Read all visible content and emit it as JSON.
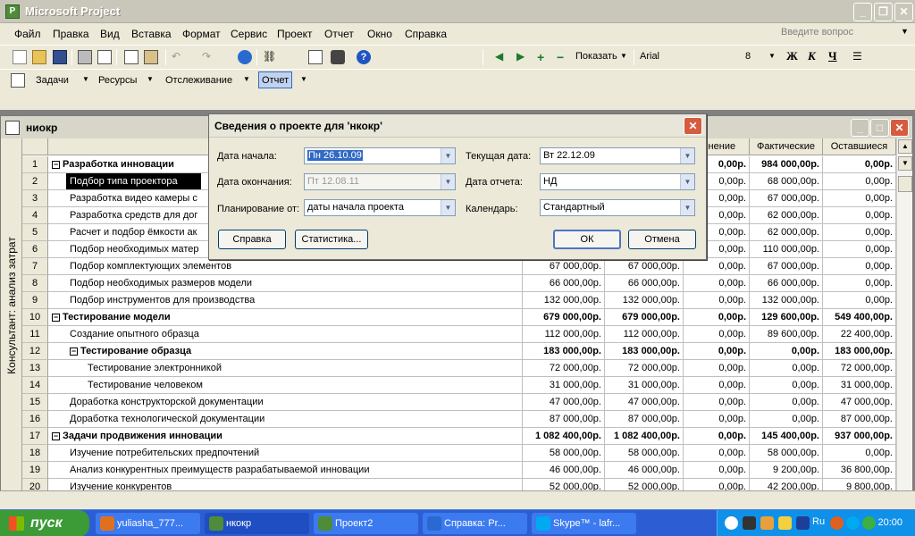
{
  "app": {
    "title": "Microsoft Project"
  },
  "menu": {
    "items": [
      "Файл",
      "Правка",
      "Вид",
      "Вставка",
      "Формат",
      "Сервис",
      "Проект",
      "Отчет",
      "Окно",
      "Справка"
    ],
    "help_placeholder": "Введите вопрос"
  },
  "toolbar": {
    "show_label": "Показать",
    "font_name": "Arial",
    "font_size": "8",
    "bold": "Ж",
    "italic": "К",
    "underline": "Ч"
  },
  "toolbar2": {
    "tasks": "Задачи",
    "resources": "Ресурсы",
    "tracking": "Отслеживание",
    "report": "Отчет"
  },
  "document": {
    "title": "ниокр",
    "sidebar_label": "Консультант: анализ затрат",
    "columns": [
      "",
      "",
      "",
      "",
      "лонение",
      "Фактические",
      "Оставшиеся"
    ],
    "rows": [
      {
        "id": "1",
        "name": "Разработка инновации",
        "level": 0,
        "summary": true,
        "c1": "",
        "c2": "",
        "c3": "0,00р.",
        "c4": "984 000,00р.",
        "c5": "0,00р."
      },
      {
        "id": "2",
        "name": "Подбор типа проектора",
        "level": 1,
        "selected": true,
        "c1": "",
        "c2": "",
        "c3": "0,00р.",
        "c4": "68 000,00р.",
        "c5": "0,00р."
      },
      {
        "id": "3",
        "name": "Разработка видео камеры с",
        "level": 1,
        "c1": "",
        "c2": "",
        "c3": "0,00р.",
        "c4": "67 000,00р.",
        "c5": "0,00р."
      },
      {
        "id": "4",
        "name": "Разработка средств для дог",
        "level": 1,
        "c1": "",
        "c2": "",
        "c3": "0,00р.",
        "c4": "62 000,00р.",
        "c5": "0,00р."
      },
      {
        "id": "5",
        "name": "Расчет и подбор ёмкости ак",
        "level": 1,
        "c1": "",
        "c2": "",
        "c3": "0,00р.",
        "c4": "62 000,00р.",
        "c5": "0,00р."
      },
      {
        "id": "6",
        "name": "Подбор необходимых матер",
        "level": 1,
        "c1": "",
        "c2": "",
        "c3": "0,00р.",
        "c4": "110 000,00р.",
        "c5": "0,00р."
      },
      {
        "id": "7",
        "name": "Подбор комплектующих элементов",
        "level": 1,
        "c1": "67 000,00р.",
        "c2": "67 000,00р.",
        "c3": "0,00р.",
        "c4": "67 000,00р.",
        "c5": "0,00р."
      },
      {
        "id": "8",
        "name": "Подбор необходимых размеров модели",
        "level": 1,
        "c1": "66 000,00р.",
        "c2": "66 000,00р.",
        "c3": "0,00р.",
        "c4": "66 000,00р.",
        "c5": "0,00р."
      },
      {
        "id": "9",
        "name": "Подбор инструментов для производства",
        "level": 1,
        "c1": "132 000,00р.",
        "c2": "132 000,00р.",
        "c3": "0,00р.",
        "c4": "132 000,00р.",
        "c5": "0,00р."
      },
      {
        "id": "10",
        "name": "Тестирование модели",
        "level": 0,
        "summary": true,
        "c1": "679 000,00р.",
        "c2": "679 000,00р.",
        "c3": "0,00р.",
        "c4": "129 600,00р.",
        "c5": "549 400,00р."
      },
      {
        "id": "11",
        "name": "Создание опытного образца",
        "level": 1,
        "c1": "112 000,00р.",
        "c2": "112 000,00р.",
        "c3": "0,00р.",
        "c4": "89 600,00р.",
        "c5": "22 400,00р."
      },
      {
        "id": "12",
        "name": "Тестирование образца",
        "level": 1,
        "summary": true,
        "c1": "183 000,00р.",
        "c2": "183 000,00р.",
        "c3": "0,00р.",
        "c4": "0,00р.",
        "c5": "183 000,00р."
      },
      {
        "id": "13",
        "name": "Тестирование электронникой",
        "level": 2,
        "c1": "72 000,00р.",
        "c2": "72 000,00р.",
        "c3": "0,00р.",
        "c4": "0,00р.",
        "c5": "72 000,00р."
      },
      {
        "id": "14",
        "name": "Тестирование человеком",
        "level": 2,
        "c1": "31 000,00р.",
        "c2": "31 000,00р.",
        "c3": "0,00р.",
        "c4": "0,00р.",
        "c5": "31 000,00р."
      },
      {
        "id": "15",
        "name": "Доработка конструкторской документации",
        "level": 1,
        "c1": "47 000,00р.",
        "c2": "47 000,00р.",
        "c3": "0,00р.",
        "c4": "0,00р.",
        "c5": "47 000,00р."
      },
      {
        "id": "16",
        "name": "Доработка технологической документации",
        "level": 1,
        "c1": "87 000,00р.",
        "c2": "87 000,00р.",
        "c3": "0,00р.",
        "c4": "0,00р.",
        "c5": "87 000,00р."
      },
      {
        "id": "17",
        "name": "Задачи продвижения инновации",
        "level": 0,
        "summary": true,
        "c1": "1 082 400,00р.",
        "c2": "1 082 400,00р.",
        "c3": "0,00р.",
        "c4": "145 400,00р.",
        "c5": "937 000,00р."
      },
      {
        "id": "18",
        "name": "Изучение потребительских предпочтений",
        "level": 1,
        "c1": "58 000,00р.",
        "c2": "58 000,00р.",
        "c3": "0,00р.",
        "c4": "58 000,00р.",
        "c5": "0,00р."
      },
      {
        "id": "19",
        "name": "Анализ конкурентных преимуществ разрабатываемой инновации",
        "level": 1,
        "c1": "46 000,00р.",
        "c2": "46 000,00р.",
        "c3": "0,00р.",
        "c4": "9 200,00р.",
        "c5": "36 800,00р."
      },
      {
        "id": "20",
        "name": "Изучение конкурентов",
        "level": 1,
        "c1": "52 000,00р.",
        "c2": "52 000,00р.",
        "c3": "0,00р.",
        "c4": "42 200,00р.",
        "c5": "9 800,00р."
      }
    ]
  },
  "dialog": {
    "title": "Сведения о проекте для 'нкокр'",
    "start_date_label": "Дата начала:",
    "start_date_value": "Пн 26.10.09",
    "finish_date_label": "Дата окончания:",
    "finish_date_value": "Пт 12.08.11",
    "schedule_from_label": "Планирование от:",
    "schedule_from_value": "даты начала проекта",
    "current_date_label": "Текущая дата:",
    "current_date_value": "Вт 22.12.09",
    "status_date_label": "Дата отчета:",
    "status_date_value": "НД",
    "calendar_label": "Календарь:",
    "calendar_value": "Стандартный",
    "help_button": "Справка",
    "stats_button": "Статистика...",
    "ok_button": "ОК",
    "cancel_button": "Отмена"
  },
  "taskbar": {
    "start": "пуск",
    "tasks": [
      "yuliasha_777...",
      "нкокр",
      "Проект2",
      "Справка: Pr...",
      "Skype™ - lafr..."
    ],
    "active_index": 1,
    "lang": "Ru",
    "clock": "20:00"
  }
}
